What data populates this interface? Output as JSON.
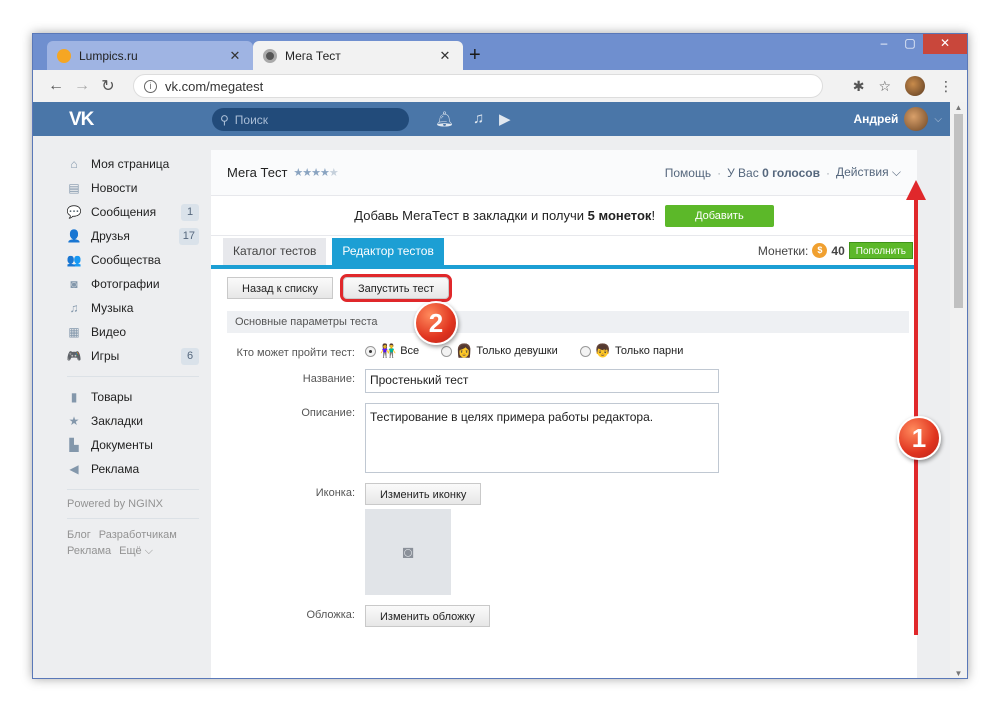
{
  "browser": {
    "tabs": [
      {
        "title": "Lumpics.ru",
        "close": "✕"
      },
      {
        "title": "Мега Тест",
        "close": "✕"
      }
    ],
    "new_tab": "+",
    "url": "vk.com/megatest",
    "controls": {
      "minimize": "‒",
      "maximize": "▢",
      "close": "✕"
    }
  },
  "vk": {
    "search_placeholder": "Поиск",
    "user_name": "Андрей",
    "menu": [
      {
        "label": "Моя страница",
        "icon": "home-icon",
        "glyph": "⌂"
      },
      {
        "label": "Новости",
        "icon": "news-icon",
        "glyph": "▤"
      },
      {
        "label": "Сообщения",
        "icon": "messages-icon",
        "glyph": "💬",
        "count": "1"
      },
      {
        "label": "Друзья",
        "icon": "friends-icon",
        "glyph": "👤",
        "count": "17"
      },
      {
        "label": "Сообщества",
        "icon": "groups-icon",
        "glyph": "👥"
      },
      {
        "label": "Фотографии",
        "icon": "camera-icon",
        "glyph": "◙"
      },
      {
        "label": "Музыка",
        "icon": "music-icon",
        "glyph": "♫"
      },
      {
        "label": "Видео",
        "icon": "video-icon",
        "glyph": "▦"
      },
      {
        "label": "Игры",
        "icon": "games-icon",
        "glyph": "🎮",
        "count": "6"
      }
    ],
    "menu2": [
      {
        "label": "Товары",
        "icon": "bag-icon",
        "glyph": "▮"
      },
      {
        "label": "Закладки",
        "icon": "star-icon",
        "glyph": "★"
      },
      {
        "label": "Документы",
        "icon": "document-icon",
        "glyph": "▙"
      },
      {
        "label": "Реклама",
        "icon": "megaphone-icon",
        "glyph": "◀"
      }
    ],
    "powered": "Powered by NGINX",
    "footer_links": [
      "Блог",
      "Разработчикам",
      "Реклама",
      "Ещё ⌵"
    ]
  },
  "app": {
    "title": "Мега Тест",
    "stars": "★★★★",
    "stars_off": "★",
    "header_links": {
      "help": "Помощь",
      "votes_prefix": "У Вас",
      "votes": "0 голосов",
      "actions": "Действия ⌵"
    },
    "banner": {
      "text_before": "Добавь МегаТест в закладки и получи",
      "bold": "5 монеток",
      "text_after": "!",
      "button": "Добавить"
    },
    "tabs": [
      "Каталог тестов",
      "Редактор тестов"
    ],
    "coins": {
      "label": "Монетки:",
      "value": "40",
      "button": "Пополнить"
    },
    "buttons": {
      "back": "Назад к списку",
      "run": "Запустить тест"
    },
    "section_title": "Основные параметры теста",
    "who_label": "Кто может пройти тест:",
    "who_options": [
      "Все",
      "Только девушки",
      "Только парни"
    ],
    "name_label": "Название:",
    "name_value": "Простенький тест",
    "desc_label": "Описание:",
    "desc_value": "Тестирование в целях примера работы редактора.",
    "icon_label": "Иконка:",
    "icon_button": "Изменить иконку",
    "cover_label": "Обложка:",
    "cover_button": "Изменить обложку"
  },
  "annotations": {
    "marker1": "1",
    "marker2": "2"
  },
  "colors": {
    "vk_header": "#4a76a8",
    "accent_tab": "#1c9fd4",
    "green": "#5cb829",
    "annotation": "#e0282b"
  }
}
